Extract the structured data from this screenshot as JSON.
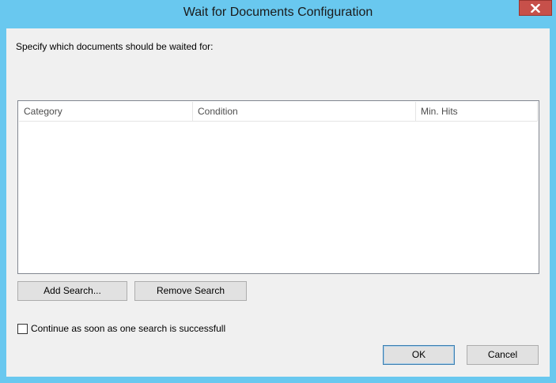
{
  "window": {
    "title": "Wait for Documents Configuration",
    "close_icon": "close-icon"
  },
  "instruction": "Specify which documents should be waited for:",
  "table": {
    "columns": [
      "Category",
      "Condition",
      "Min. Hits"
    ],
    "rows": []
  },
  "buttons": {
    "add_search": "Add Search...",
    "remove_search": "Remove Search",
    "ok": "OK",
    "cancel": "Cancel"
  },
  "checkbox": {
    "label": "Continue as soon as one search is successfull",
    "checked": false
  },
  "colors": {
    "frame": "#69c8ef",
    "close_button": "#c7504a",
    "client": "#f0f0f0"
  }
}
